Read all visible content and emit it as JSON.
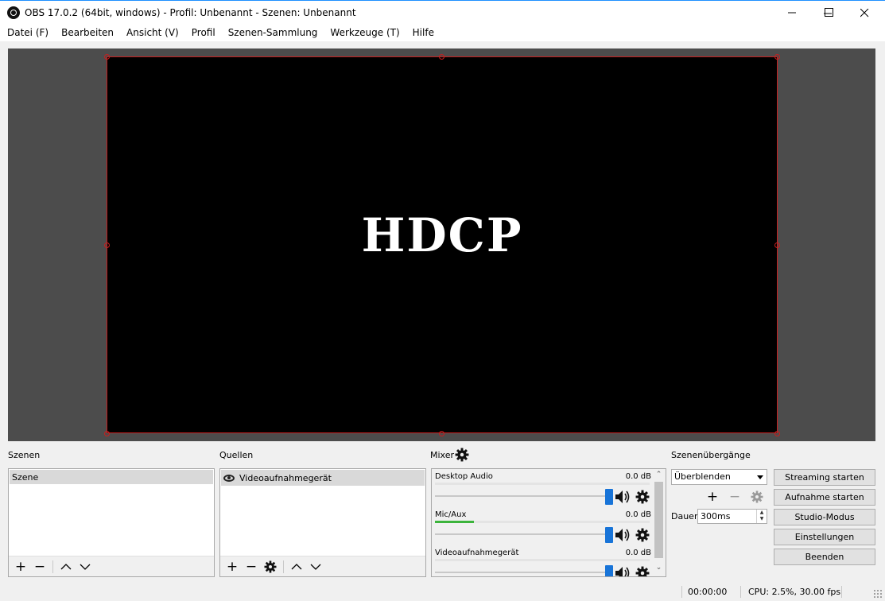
{
  "window": {
    "title": "OBS 17.0.2 (64bit, windows) - Profil: Unbenannt - Szenen: Unbenannt",
    "minimize": "—",
    "maximize": "☐",
    "close": "✕"
  },
  "menu": [
    "Datei (F)",
    "Bearbeiten",
    "Ansicht (V)",
    "Profil",
    "Szenen-Sammlung",
    "Werkzeuge (T)",
    "Hilfe"
  ],
  "preview": {
    "content_text": "HDCP",
    "selection_color": "#c81e1e"
  },
  "docks": {
    "scenes": {
      "label": "Szenen",
      "items": [
        "Szene"
      ]
    },
    "sources": {
      "label": "Quellen",
      "items": [
        "Videoaufnahmegerät"
      ]
    },
    "mixer": {
      "label": "Mixer",
      "channels": [
        {
          "name": "Desktop Audio",
          "db": "0.0 dB",
          "level": 0.0,
          "volume": 1.0
        },
        {
          "name": "Mic/Aux",
          "db": "0.0 dB",
          "level": 0.18,
          "volume": 1.0
        },
        {
          "name": "Videoaufnahmegerät",
          "db": "0.0 dB",
          "level": 0.0,
          "volume": 1.0
        }
      ]
    },
    "transitions": {
      "label": "Szenenübergänge",
      "selected": "Überblenden",
      "duration_label": "Dauer",
      "duration_value": "300ms"
    },
    "controls": {
      "stream": "Streaming starten",
      "record": "Aufnahme starten",
      "studio": "Studio-Modus",
      "settings": "Einstellungen",
      "exit": "Beenden"
    }
  },
  "status": {
    "time": "00:00:00",
    "cpu": "CPU: 2.5%, 30.00 fps"
  },
  "colors": {
    "accent": "#1874d8",
    "meter": "#3cb43c"
  }
}
